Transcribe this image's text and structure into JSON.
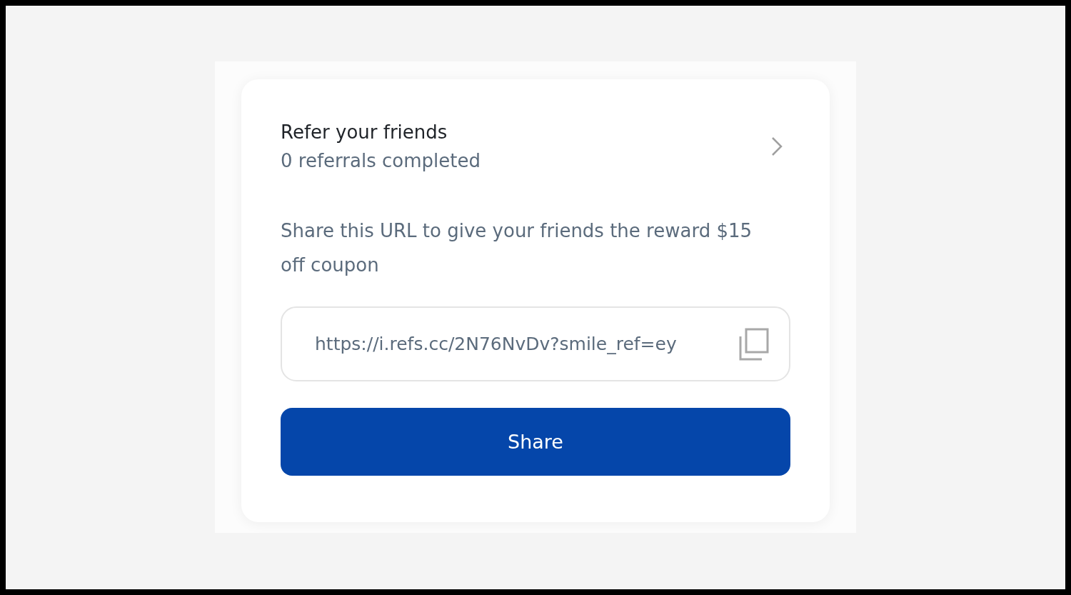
{
  "referral": {
    "title": "Refer your friends",
    "subtitle": "0 referrals completed"
  },
  "description": "Share this URL to give your friends the reward $15 off coupon",
  "url_field": {
    "value": "https://i.refs.cc/2N76NvDv?smile_ref=ey"
  },
  "share_button": {
    "label": "Share"
  }
}
